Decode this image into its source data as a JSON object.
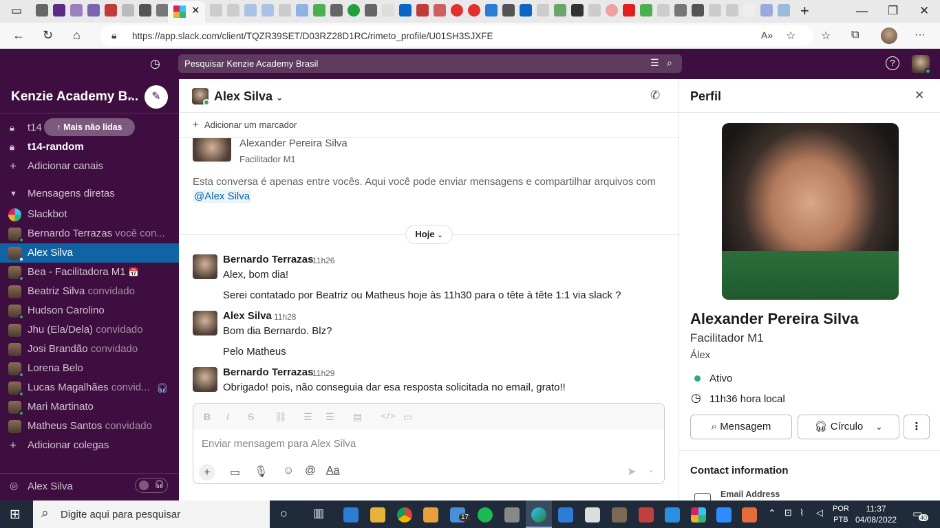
{
  "browser": {
    "url": "https://app.slack.com/client/TQZR39SET/D03RZ28D1RC/rimeto_profile/U01SH3SJXFE"
  },
  "slack": {
    "search_placeholder": "Pesquisar Kenzie Academy Brasil",
    "workspace_name": "Kenzie Academy B...",
    "sidebar": {
      "partial_channel": "t14",
      "unread_pill": "Mais não lidas",
      "channel_random": "t14-random",
      "add_channels": "Adicionar canais",
      "dm_section": "Mensagens diretas",
      "dms": [
        {
          "name": "Slackbot",
          "sub": ""
        },
        {
          "name": "Bernardo Terrazas",
          "sub": "você con..."
        },
        {
          "name": "Alex Silva",
          "sub": ""
        },
        {
          "name": "Bea - Facilitadora M1",
          "sub": ""
        },
        {
          "name": "Beatriz Silva",
          "sub": "convidado"
        },
        {
          "name": "Hudson Carolino",
          "sub": ""
        },
        {
          "name": "Jhu (Ela/Dela)",
          "sub": "convidado"
        },
        {
          "name": "Josi Brandão",
          "sub": "convidado"
        },
        {
          "name": "Lorena Belo",
          "sub": ""
        },
        {
          "name": "Lucas Magalhães",
          "sub": "convid..."
        },
        {
          "name": "Mari Martinato",
          "sub": ""
        },
        {
          "name": "Matheus Santos",
          "sub": "convidado"
        }
      ],
      "add_colleagues": "Adicionar colegas",
      "footer_user": "Alex Silva"
    },
    "channel": {
      "title": "Alex Silva",
      "add_bookmark": "Adicionar um marcador",
      "intro_name": "Alexander Pereira Silva",
      "intro_title": "Facilitador M1",
      "intro_text": "Esta conversa é apenas entre vocês. Aqui você pode enviar mensagens e compartilhar arquivos com",
      "intro_mention": "@Alex Silva",
      "today_label": "Hoje",
      "messages": [
        {
          "author": "Bernardo Terrazas",
          "time": "11h26",
          "lines": [
            "Alex, bom dia!",
            "Serei contatado por Beatriz ou Matheus hoje às 11h30 para o tête à tête 1:1 via slack ?"
          ]
        },
        {
          "author": "Alex Silva",
          "time": "11h28",
          "lines": [
            "Bom dia Bernardo. Blz?",
            "Pelo Matheus"
          ]
        },
        {
          "author": "Bernardo Terrazas",
          "time": "11h29",
          "lines": [
            "Obrigado! pois, não conseguia dar esa resposta solicitada no email, grato!!"
          ]
        }
      ],
      "composer_placeholder": "Enviar mensagem para Alex Silva"
    },
    "profile": {
      "panel_title": "Perfil",
      "full_name": "Alexander Pereira Silva",
      "title": "Facilitador M1",
      "pronounce": "Álex",
      "status": "Ativo",
      "local_time": "11h36 hora local",
      "message_button": "Mensagem",
      "huddle_button": "Círculo",
      "contact_heading": "Contact information",
      "email_label": "Email Address"
    }
  },
  "taskbar": {
    "search_placeholder": "Digite aqui para pesquisar",
    "lang_1": "POR",
    "lang_2": "PTB",
    "time": "11:37",
    "date": "04/08/2022",
    "notif_count": "40",
    "mail_badge": "17"
  },
  "colors": {
    "slack_aubergine": "#3f0e40",
    "selected_blue": "#1164a3",
    "presence_green": "#2bac76"
  }
}
